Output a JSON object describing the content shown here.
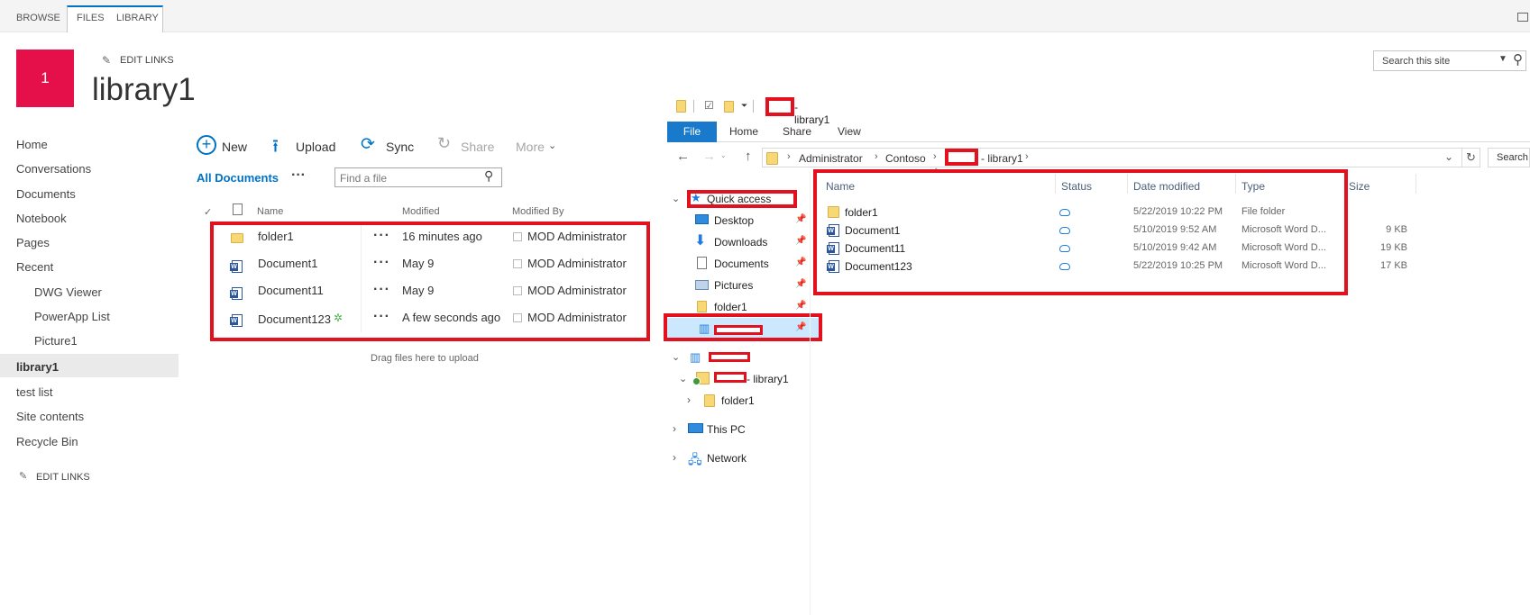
{
  "ribbon": {
    "tabs": [
      "BROWSE",
      "FILES",
      "LIBRARY"
    ]
  },
  "site": {
    "logo_text": "1",
    "edit_links": "EDIT LINKS",
    "title": "library1",
    "search_placeholder": "Search this site"
  },
  "left_nav": {
    "items": [
      "Home",
      "Conversations",
      "Documents",
      "Notebook",
      "Pages",
      "Recent"
    ],
    "recent_items": [
      "DWG Viewer",
      "PowerApp List",
      "Picture1"
    ],
    "items_after": [
      "library1",
      "test list",
      "Site contents",
      "Recycle Bin"
    ],
    "edit_links": "EDIT LINKS"
  },
  "command_bar": {
    "new": "New",
    "upload": "Upload",
    "sync": "Sync",
    "share": "Share",
    "more": "More"
  },
  "view": {
    "name": "All Documents",
    "find_placeholder": "Find a file"
  },
  "list": {
    "headers": {
      "check": "✓",
      "name": "Name",
      "modified": "Modified",
      "modified_by": "Modified By"
    },
    "rows": [
      {
        "name": "folder1",
        "modified": "16 minutes ago",
        "by": "MOD Administrator"
      },
      {
        "name": "Document1",
        "modified": "May 9",
        "by": "MOD Administrator"
      },
      {
        "name": "Document11",
        "modified": "May 9",
        "by": "MOD Administrator"
      },
      {
        "name": "Document123",
        "modified": "A few seconds ago",
        "by": "MOD Administrator",
        "new_badge": "✲"
      }
    ],
    "drop_hint": "Drag files here to upload"
  },
  "explorer": {
    "title_suffix": "- library1",
    "ribbon_tabs": [
      "File",
      "Home",
      "Share",
      "View"
    ],
    "breadcrumb": [
      "Administrator",
      "Contoso",
      "- library1"
    ],
    "search_placeholder": "Search",
    "nav": {
      "quick_access": "Quick access",
      "qa_items": [
        "Desktop",
        "Downloads",
        "Documents",
        "Pictures",
        "folder1"
      ],
      "library_node": "- library1",
      "folder_node": "folder1",
      "this_pc": "This PC",
      "network": "Network"
    },
    "columns": {
      "name": "Name",
      "status": "Status",
      "date": "Date modified",
      "type": "Type",
      "size": "Size"
    },
    "files": [
      {
        "name": "folder1",
        "date": "5/22/2019 10:22 PM",
        "type": "File folder",
        "size": ""
      },
      {
        "name": "Document1",
        "date": "5/10/2019 9:52 AM",
        "type": "Microsoft Word D...",
        "size": "9 KB"
      },
      {
        "name": "Document11",
        "date": "5/10/2019 9:42 AM",
        "type": "Microsoft Word D...",
        "size": "19 KB"
      },
      {
        "name": "Document123",
        "date": "5/22/2019 10:25 PM",
        "type": "Microsoft Word D...",
        "size": "17 KB"
      }
    ]
  },
  "colors": {
    "accent": "#0072c6",
    "logo": "#e5104a",
    "highlight": "#e3101d"
  }
}
